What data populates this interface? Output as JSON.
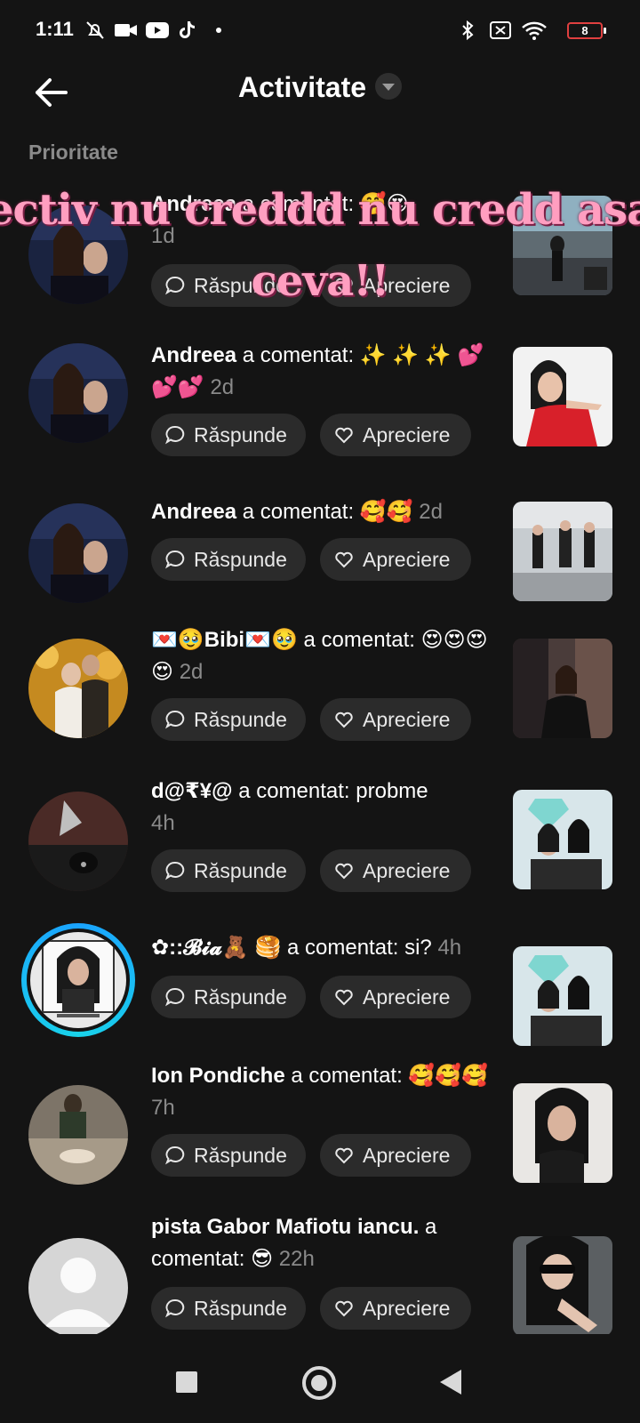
{
  "status_bar": {
    "time": "1:11",
    "battery": "8",
    "icons": [
      "bell-off-icon",
      "video-camera-icon",
      "youtube-icon",
      "tiktok-icon",
      "dot-icon",
      "bluetooth-icon",
      "sim-off-icon",
      "wifi-icon",
      "battery-icon"
    ]
  },
  "header": {
    "title": "Activitate",
    "back_icon": "back-arrow-icon",
    "dropdown_icon": "chevron-down-icon"
  },
  "section_label": "Prioritate",
  "overlay_caption": "ectiv nu creddd nu credd asa ceva!!",
  "buttons": {
    "reply_label": "Răspunde",
    "like_label": "Apreciere"
  },
  "notifications": [
    {
      "user": "Andreea",
      "action": "a comentat:",
      "comment": "🥰😍",
      "time": "1d"
    },
    {
      "user": "Andreea",
      "action": "a comentat:",
      "comment": "✨ ✨ ✨ 💕💕💕",
      "time": "2d"
    },
    {
      "user": "Andreea",
      "action": "a comentat:",
      "comment": "🥰🥰",
      "time": "2d"
    },
    {
      "user": "💌🥹Bibi💌🥹",
      "action": "a comentat:",
      "comment": "😍😍😍😍",
      "time": "2d"
    },
    {
      "user": "d@₹¥@",
      "action": "a comentat:",
      "comment": "probme",
      "time": "4h"
    },
    {
      "user": "✿::𝓑𝓲𝓪🧸 🥞",
      "action": "a comentat:",
      "comment": "si?",
      "time": "4h"
    },
    {
      "user": "Ion Pondiche",
      "action": "a comentat:",
      "comment": "🥰🥰🥰",
      "time": "7h"
    },
    {
      "user": "pista Gabor Mafiotu iancu.",
      "action": "a comentat:",
      "comment": "😎",
      "time": "22h"
    }
  ],
  "nav_bar": {
    "icons": [
      "recents-square-icon",
      "home-circle-icon",
      "back-triangle-icon"
    ]
  },
  "colors": {
    "background": "#141414",
    "button_bg": "#2b2b2b",
    "muted_text": "#8a8a8a",
    "story_ring": "#1aa3ff",
    "caption": "#ff9ec0"
  }
}
